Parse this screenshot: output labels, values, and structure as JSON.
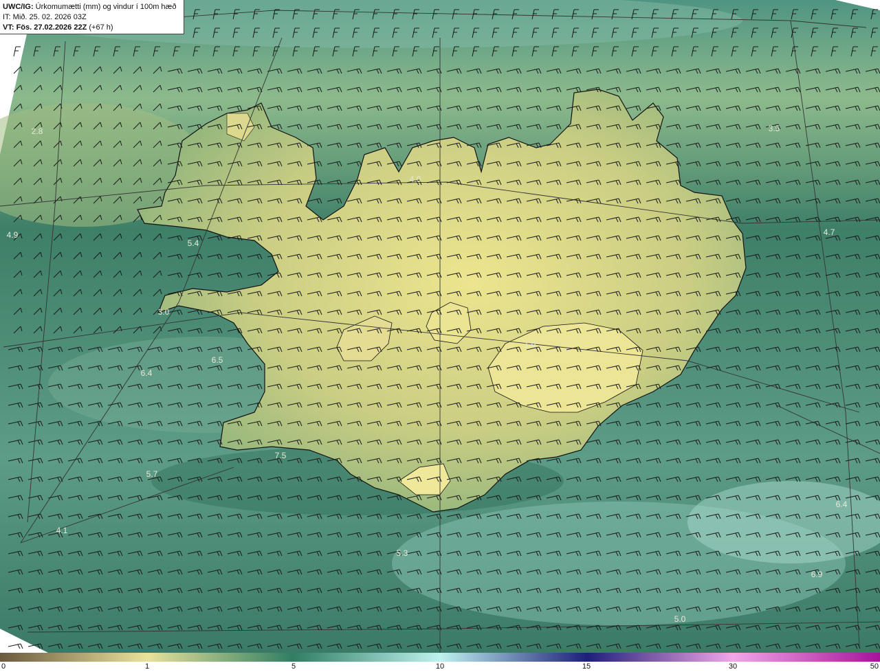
{
  "header": {
    "product": "UWC/IG:",
    "title": "Úrkomumætti (mm) og vindur í 100m hæð",
    "init_time": "IT: Mið. 25. 02. 2026 03Z",
    "valid_prefix": "VT:",
    "valid_time": "Fös. 27.02.2026 22Z",
    "lead": "(+67 h)"
  },
  "colors": {
    "sea_dark": "#2b6a55",
    "sea_mid": "#4f8f7a",
    "land_high": "#e6e18e",
    "land_mid": "#b8c27d",
    "coast": "#111111",
    "graticule": "#333333",
    "barb": "#1a1a1a"
  },
  "value_labels": [
    {
      "text": "2.8"
    },
    {
      "text": "4.0"
    },
    {
      "text": "3.5"
    },
    {
      "text": "4.9"
    },
    {
      "text": "5.4"
    },
    {
      "text": "4.7"
    },
    {
      "text": "3.0"
    },
    {
      "text": "6.5"
    },
    {
      "text": "6.4"
    },
    {
      "text": "7.5"
    },
    {
      "text": "5.7"
    },
    {
      "text": "4.1"
    },
    {
      "text": "5.3"
    },
    {
      "text": "5.0"
    },
    {
      "text": "6.4"
    },
    {
      "text": "6.9"
    },
    {
      "text": "1.9"
    }
  ],
  "colorbar": {
    "ticks": [
      "0",
      "1",
      "5",
      "10",
      "15",
      "30",
      "50"
    ],
    "stops": [
      "#6b5a40",
      "#e9e29a",
      "#2f7e63",
      "#bff2ee",
      "#1e1f7a",
      "#f2a6e8",
      "#a6139a"
    ]
  }
}
